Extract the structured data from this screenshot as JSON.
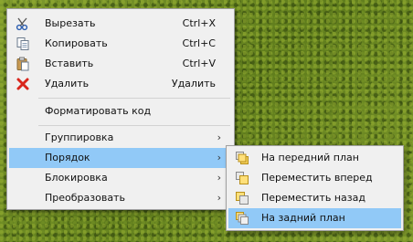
{
  "context_menu": {
    "items": [
      {
        "label": "Вырезать",
        "shortcut": "Ctrl+X",
        "icon": "scissors-icon"
      },
      {
        "label": "Копировать",
        "shortcut": "Ctrl+C",
        "icon": "copy-icon"
      },
      {
        "label": "Вставить",
        "shortcut": "Ctrl+V",
        "icon": "paste-icon"
      },
      {
        "label": "Удалить",
        "shortcut": "Удалить",
        "icon": "delete-icon"
      },
      {
        "label": "Форматировать код"
      },
      {
        "label": "Группировка"
      },
      {
        "label": "Порядок",
        "highlighted": true
      },
      {
        "label": "Блокировка"
      },
      {
        "label": "Преобразовать"
      }
    ],
    "submenu_arrow": "›"
  },
  "order_submenu": {
    "items": [
      {
        "label": "На передний план",
        "icon": "bring-to-front-icon"
      },
      {
        "label": "Переместить вперед",
        "icon": "bring-forward-icon"
      },
      {
        "label": "Переместить назад",
        "icon": "send-backward-icon"
      },
      {
        "label": "На задний план",
        "icon": "send-to-back-icon",
        "highlighted": true
      }
    ]
  },
  "colors": {
    "highlight": "#91c9f7",
    "menu_background": "#f0f0f0",
    "delete_red": "#d9261c"
  }
}
